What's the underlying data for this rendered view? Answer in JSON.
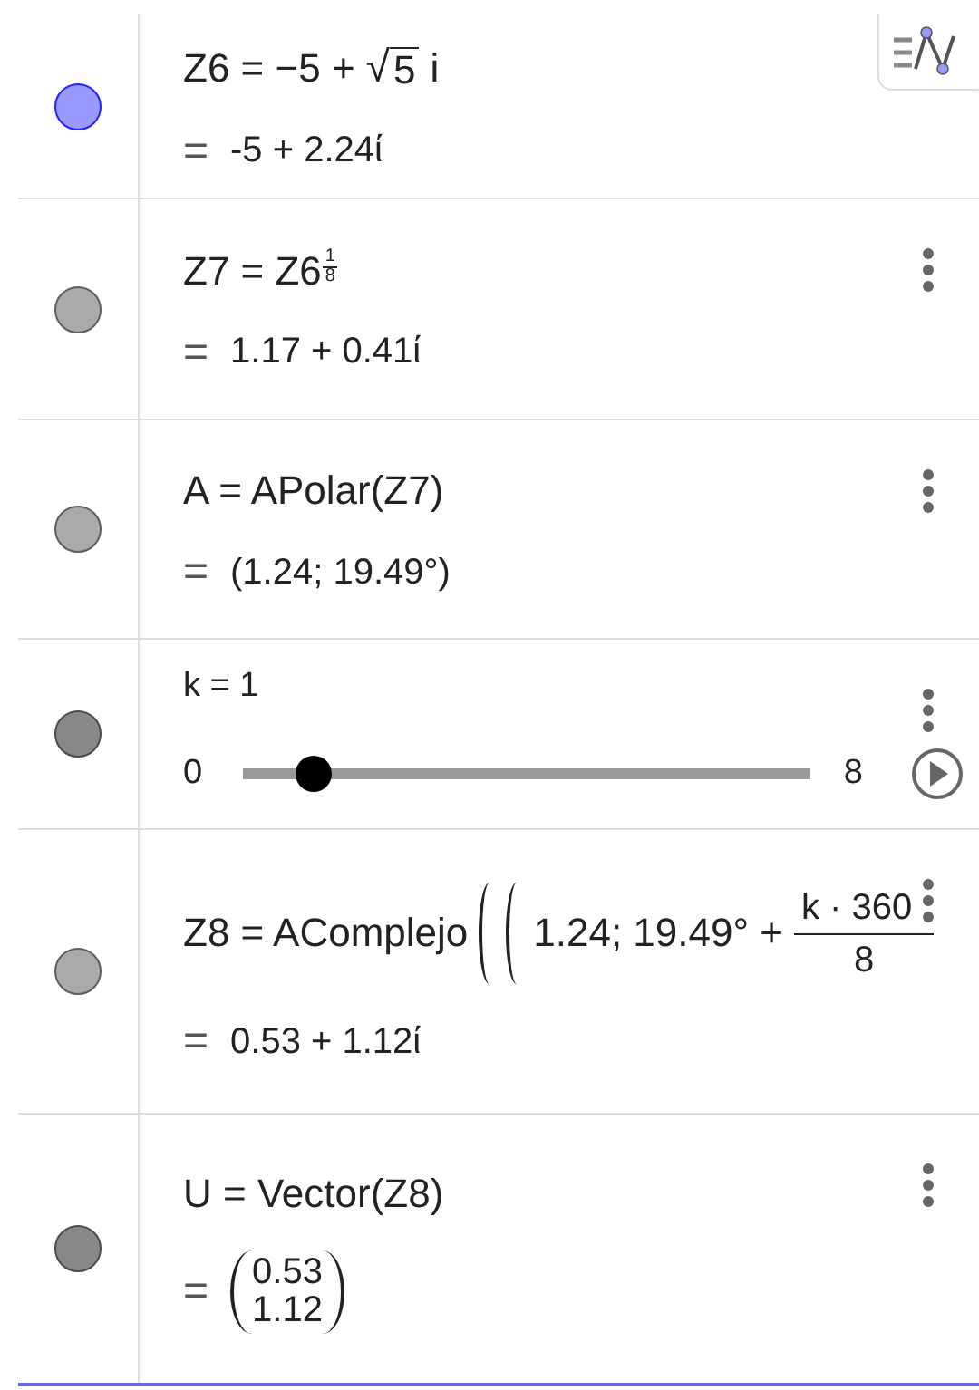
{
  "rows": [
    {
      "kind": "expression",
      "color": "#9999ff",
      "menu": false,
      "definition": [
        {
          "kind": "text",
          "text": "Z6 = −5 +"
        },
        {
          "kind": "sqrt",
          "radical": "√",
          "text": "5"
        },
        {
          "kind": "text",
          "text": "i"
        }
      ],
      "result": {
        "kind": "text",
        "eq": "=",
        "text": "-5 + 2.24ί"
      }
    },
    {
      "kind": "expression",
      "color": "#aaaaaa",
      "menu": true,
      "definition": [
        {
          "kind": "text",
          "text": "Z7 = Z6"
        },
        {
          "kind": "power_fraction",
          "num": "1",
          "den": "8"
        }
      ],
      "result": {
        "kind": "text",
        "eq": "=",
        "text": "1.17 + 0.41ί"
      }
    },
    {
      "kind": "expression",
      "color": "#aaaaaa",
      "menu": true,
      "definition": [
        {
          "kind": "text",
          "text": "A = APolar(Z7)"
        }
      ],
      "result": {
        "kind": "text",
        "eq": "=",
        "text": "(1.24; 19.49°)"
      }
    },
    {
      "kind": "slider",
      "color": "#888888",
      "menu": true,
      "label": "k = 1",
      "min": "0",
      "max": "8",
      "level": 0.125
    },
    {
      "kind": "expression",
      "color": "#aaaaaa",
      "menu": true,
      "definition": [
        {
          "kind": "text",
          "text": "Z8 = AComplejo"
        },
        {
          "kind": "paren"
        },
        {
          "kind": "paren"
        },
        {
          "kind": "text",
          "text": "1.24; 19.49° +"
        },
        {
          "kind": "fraction",
          "num": "k · 360",
          "den": "8"
        }
      ],
      "result": {
        "kind": "text",
        "eq": "=",
        "text": "0.53 + 1.12ί"
      }
    },
    {
      "kind": "expression",
      "color": "#888888",
      "menu": true,
      "definition": [
        {
          "kind": "text",
          "text": "U = Vector(Z8)"
        }
      ],
      "result": {
        "kind": "vector",
        "eq": "=",
        "entries": [
          "0.53",
          "1.12"
        ]
      }
    }
  ]
}
